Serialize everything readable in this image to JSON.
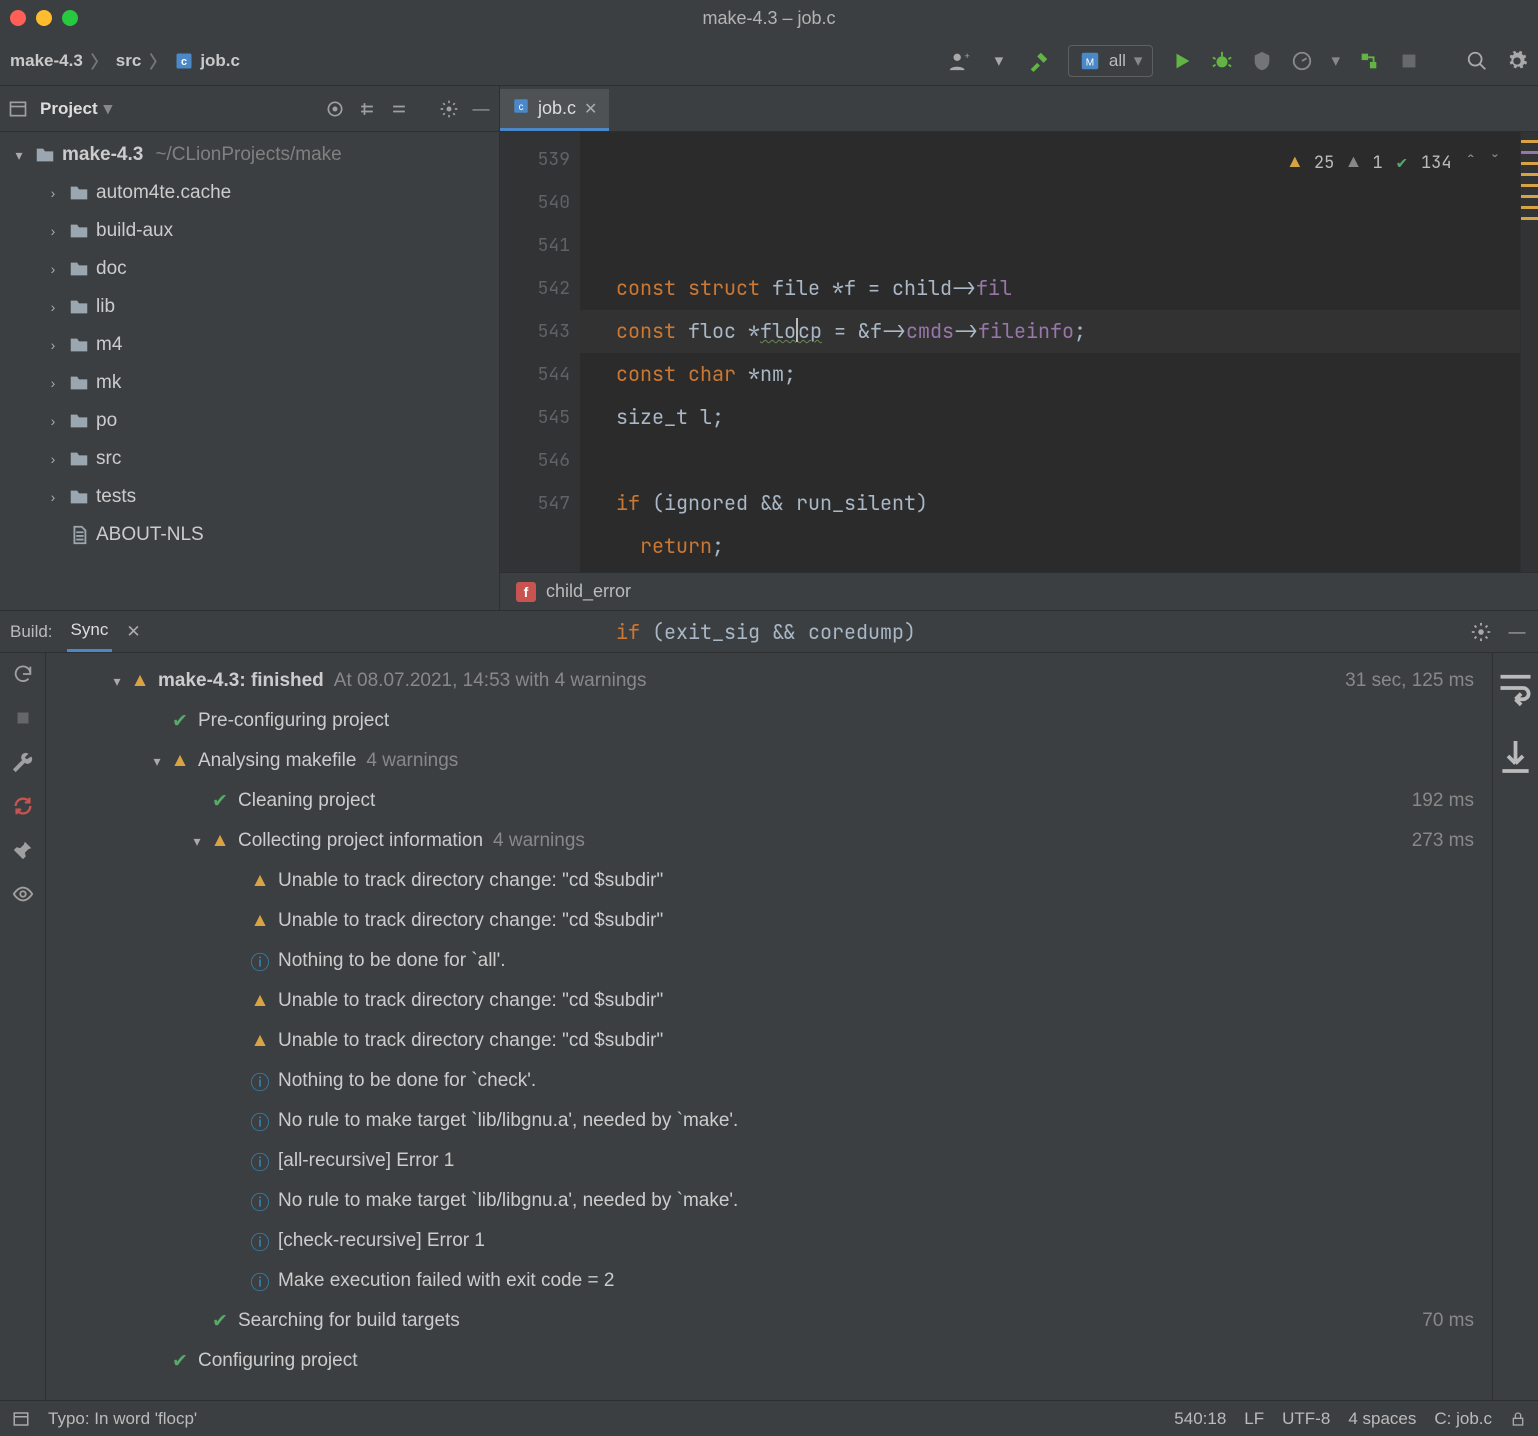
{
  "window": {
    "title": "make-4.3 – job.c"
  },
  "breadcrumb": {
    "project": "make-4.3",
    "folder": "src",
    "file": "job.c"
  },
  "run_config": {
    "label": "all"
  },
  "project_panel": {
    "title": "Project",
    "root": {
      "name": "make-4.3",
      "path": "~/CLionProjects/make"
    },
    "folders": [
      "autom4te.cache",
      "build-aux",
      "doc",
      "lib",
      "m4",
      "mk",
      "po",
      "src",
      "tests"
    ],
    "files": [
      "ABOUT-NLS"
    ]
  },
  "editor": {
    "tab_label": "job.c",
    "lines": [
      {
        "n": "539",
        "pre": "const struct ",
        "t": "file ",
        "rest": "*f = child->",
        "field": "fil"
      },
      {
        "n": "540",
        "pre": "const ",
        "t": "floc ",
        "rest": "*",
        "typo": "flocp",
        "rest2": " = &f->",
        "field": "cmds",
        "rest3": "->",
        "field2": "fileinfo",
        "tail": ";"
      },
      {
        "n": "541",
        "pre": "const char ",
        "rest": "*nm;"
      },
      {
        "n": "542",
        "t": "size_t ",
        "rest": "l;"
      },
      {
        "n": "543",
        "rest": ""
      },
      {
        "n": "544",
        "kw": "if ",
        "rest": "(ignored && run_silent)"
      },
      {
        "n": "545",
        "kw": "  return",
        "rest": ";"
      },
      {
        "n": "546",
        "rest": ""
      },
      {
        "n": "547",
        "kw": "if ",
        "rest": "(exit_sig && coredump)"
      }
    ],
    "inspections": {
      "error": "25",
      "weak": "1",
      "typos": "134"
    },
    "breadcrumb_fn": "child_error",
    "breadcrumb_badge": "f"
  },
  "build": {
    "tab_prefix": "Build:",
    "tab_label": "Sync",
    "root": {
      "project": "make-4.3:",
      "status": "finished",
      "detail": "At 08.07.2021, 14:53 with 4 warnings",
      "duration": "31 sec, 125 ms"
    },
    "steps": [
      {
        "icon": "ok",
        "indent": 2,
        "text": "Pre-configuring project"
      },
      {
        "icon": "warn",
        "indent": 2,
        "chev": true,
        "text": "Analysing makefile",
        "sub": "4 warnings"
      },
      {
        "icon": "ok",
        "indent": 3,
        "text": "Cleaning project",
        "time": "192 ms"
      },
      {
        "icon": "warn",
        "indent": 3,
        "chev": true,
        "text": "Collecting project information",
        "sub": "4 warnings",
        "time": "273 ms"
      },
      {
        "icon": "warn",
        "indent": 4,
        "text": "Unable to track directory change: \"cd $subdir\""
      },
      {
        "icon": "warn",
        "indent": 4,
        "text": "Unable to track directory change: \"cd $subdir\""
      },
      {
        "icon": "info",
        "indent": 4,
        "text": "Nothing to be done for `all'."
      },
      {
        "icon": "warn",
        "indent": 4,
        "text": "Unable to track directory change: \"cd $subdir\""
      },
      {
        "icon": "warn",
        "indent": 4,
        "text": "Unable to track directory change: \"cd $subdir\""
      },
      {
        "icon": "info",
        "indent": 4,
        "text": "Nothing to be done for `check'."
      },
      {
        "icon": "info",
        "indent": 4,
        "text": "No rule to make target `lib/libgnu.a', needed by `make'."
      },
      {
        "icon": "info",
        "indent": 4,
        "text": "[all-recursive] Error 1"
      },
      {
        "icon": "info",
        "indent": 4,
        "text": "No rule to make target `lib/libgnu.a', needed by `make'."
      },
      {
        "icon": "info",
        "indent": 4,
        "text": "[check-recursive] Error 1"
      },
      {
        "icon": "info",
        "indent": 4,
        "text": "Make execution failed with exit code = 2"
      },
      {
        "icon": "ok",
        "indent": 3,
        "text": "Searching for build targets",
        "time": "70 ms"
      },
      {
        "icon": "ok",
        "indent": 2,
        "text": "Configuring project"
      }
    ]
  },
  "status": {
    "message": "Typo: In word 'flocp'",
    "position": "540:18",
    "line_sep": "LF",
    "encoding": "UTF-8",
    "indent": "4 spaces",
    "context": "C: job.c"
  }
}
